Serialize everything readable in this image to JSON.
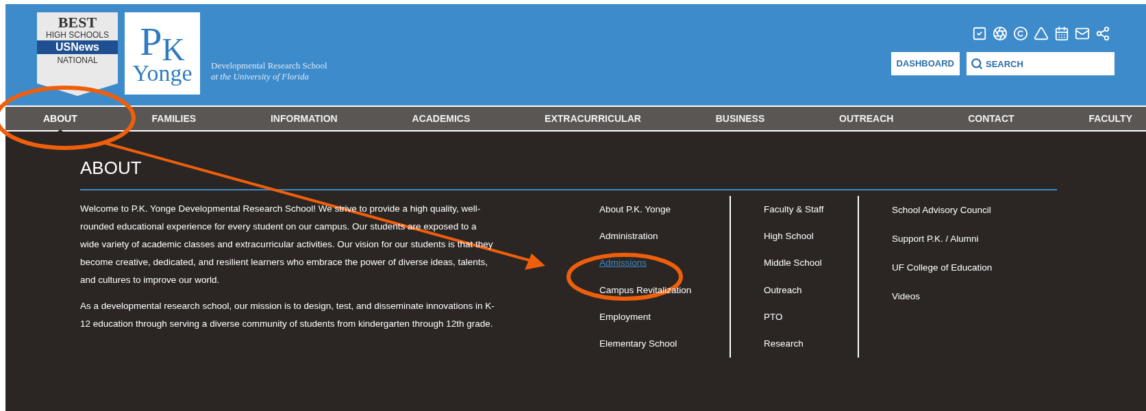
{
  "header": {
    "badge": {
      "lines": [
        "BEST",
        "HIGH SCHOOLS",
        "USNews",
        "NATIONAL"
      ]
    },
    "logo": {
      "letters": [
        "P",
        "K"
      ],
      "word": "Yonge"
    },
    "tagline": [
      "Developmental Research School",
      "at the University of Florida"
    ],
    "dashboard_button": "DASHBOARD",
    "search": {
      "placeholder": "SEARCH"
    }
  },
  "nav": [
    {
      "label": "ABOUT",
      "selected": true
    },
    {
      "label": "FAMILIES",
      "selected": false
    },
    {
      "label": "INFORMATION",
      "selected": false
    },
    {
      "label": "ACADEMICS",
      "selected": false
    },
    {
      "label": "EXTRACURRICULAR",
      "selected": false
    },
    {
      "label": "BUSINESS",
      "selected": false
    },
    {
      "label": "OUTREACH",
      "selected": false
    },
    {
      "label": "CONTACT",
      "selected": false
    },
    {
      "label": "FACULTY",
      "selected": false
    }
  ],
  "dropdown": {
    "title": "ABOUT",
    "paragraphs": [
      "Welcome to P.K. Yonge Developmental Research School! We strive to provide a high quality, well-rounded educational experience for every student on our campus. Our students are exposed to a wide variety of academic classes and extracurricular activities. Our vision for our students is that they become creative, dedicated, and resilient learners who embrace the power of diverse ideas, talents, and cultures to improve our world.",
      "As a developmental research school, our mission is to design, test, and disseminate innovations in K-12 education through serving a diverse community of students from kindergarten through 12th grade."
    ],
    "columns": [
      [
        {
          "label": "About P.K. Yonge",
          "selected": false
        },
        {
          "label": "Administration",
          "selected": false
        },
        {
          "label": "Admissions",
          "selected": true
        },
        {
          "label": "Campus Revitalization",
          "selected": false
        },
        {
          "label": "Employment",
          "selected": false
        },
        {
          "label": "Elementary School",
          "selected": false
        }
      ],
      [
        {
          "label": "Faculty & Staff",
          "selected": false
        },
        {
          "label": "High School",
          "selected": false
        },
        {
          "label": "Middle School",
          "selected": false
        },
        {
          "label": "Outreach",
          "selected": false
        },
        {
          "label": "PTO",
          "selected": false
        },
        {
          "label": "Research",
          "selected": false
        }
      ],
      [
        {
          "label": "School Advisory Council",
          "selected": false
        },
        {
          "label": "Support P.K. / Alumni",
          "selected": false
        },
        {
          "label": "UF College of Education",
          "selected": false
        },
        {
          "label": "Videos",
          "selected": false
        }
      ]
    ]
  }
}
